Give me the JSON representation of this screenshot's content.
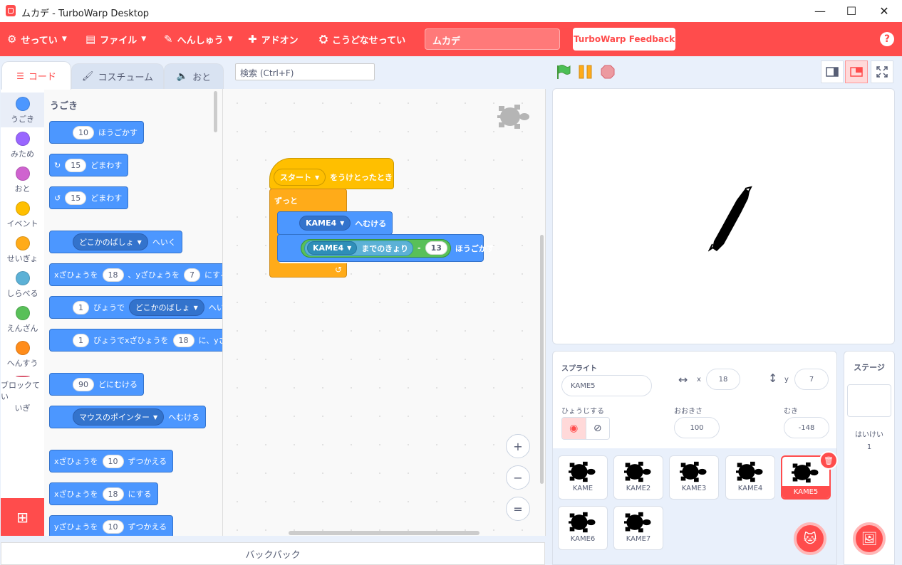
{
  "window": {
    "title": "ムカデ - TurboWarp Desktop",
    "minimize": "—",
    "maximize": "☐",
    "close": "✕"
  },
  "menu": {
    "settings": "せってい",
    "file": "ファイル",
    "edit": "へんしゅう",
    "addons": "アドオン",
    "how_it_works": "こうどなせってい",
    "project_title": "ムカデ",
    "feedback": "TurboWarp Feedback",
    "help": "?"
  },
  "tabs": {
    "code": "コード",
    "costumes": "コスチューム",
    "sounds": "おと"
  },
  "search": {
    "placeholder": "検索 (Ctrl+F)"
  },
  "categories": [
    {
      "label": "うごき",
      "color": "#4c97ff"
    },
    {
      "label": "みため",
      "color": "#9966ff"
    },
    {
      "label": "おと",
      "color": "#cf63cf"
    },
    {
      "label": "イベント",
      "color": "#ffbf00"
    },
    {
      "label": "せいぎょ",
      "color": "#ffab19"
    },
    {
      "label": "しらべる",
      "color": "#5cb1d6"
    },
    {
      "label": "えんざん",
      "color": "#59c059"
    },
    {
      "label": "へんすう",
      "color": "#ff8c1a"
    },
    {
      "label": "ブロックてい",
      "label2": "いぎ",
      "color": "#ff6680"
    }
  ],
  "palette": {
    "section": "うごき",
    "b1": {
      "n": "10",
      "t": "ほうごかす"
    },
    "b2": {
      "n": "15",
      "t": "どまわす"
    },
    "b3": {
      "n": "15",
      "t": "どまわす"
    },
    "b4": {
      "d": "どこかのばしょ",
      "t": "へいく"
    },
    "b5": {
      "t1": "xざひょうを",
      "n1": "18",
      "t2": "、yざひょうを",
      "n2": "7",
      "t3": "にする"
    },
    "b6": {
      "n": "1",
      "t1": "びょうで",
      "d": "どこかのばしょ",
      "t2": "へい"
    },
    "b7": {
      "n1": "1",
      "t1": "びょうでxざひょうを",
      "n2": "18",
      "t2": "に、yざ"
    },
    "b8": {
      "n": "90",
      "t": "どにむける"
    },
    "b9": {
      "d": "マウスのポインター",
      "t": "へむける"
    },
    "b10": {
      "t1": "xざひょうを",
      "n": "10",
      "t2": "ずつかえる"
    },
    "b11": {
      "t1": "xざひょうを",
      "n": "18",
      "t2": "にする"
    },
    "b12": {
      "t1": "yざひょうを",
      "n": "10",
      "t2": "ずつかえる"
    }
  },
  "script": {
    "hat_drop": "スタート",
    "hat_text": "をうけとったとき",
    "forever": "ずっと",
    "point_drop": "KAME4",
    "point_text": "へむける",
    "move_drop": "KAME4",
    "move_dist": "までのきょり",
    "minus": "-",
    "move_num": "13",
    "move_text": "ほうごかす"
  },
  "zoom": {
    "in": "+",
    "out": "−",
    "reset": "="
  },
  "backpack": "バックパック",
  "sprite_info": {
    "sprite_label": "スプライト",
    "sprite_name": "KAME5",
    "x_label": "x",
    "x_value": "18",
    "y_label": "y",
    "y_value": "7",
    "show_label": "ひょうじする",
    "size_label": "おおきさ",
    "size_value": "100",
    "direction_label": "むき",
    "direction_value": "-148"
  },
  "sprites": [
    "KAME",
    "KAME2",
    "KAME3",
    "KAME4",
    "KAME5",
    "KAME6",
    "KAME7"
  ],
  "stage_panel": {
    "title": "ステージ",
    "backdrops_label": "はいけい",
    "backdrops_count": "1"
  },
  "colors": {
    "accent": "#ff4c4c",
    "motion": "#4c97ff",
    "events": "#ffbf00",
    "control": "#ffab19",
    "sensing": "#5cb1d6",
    "operators": "#59c059"
  }
}
